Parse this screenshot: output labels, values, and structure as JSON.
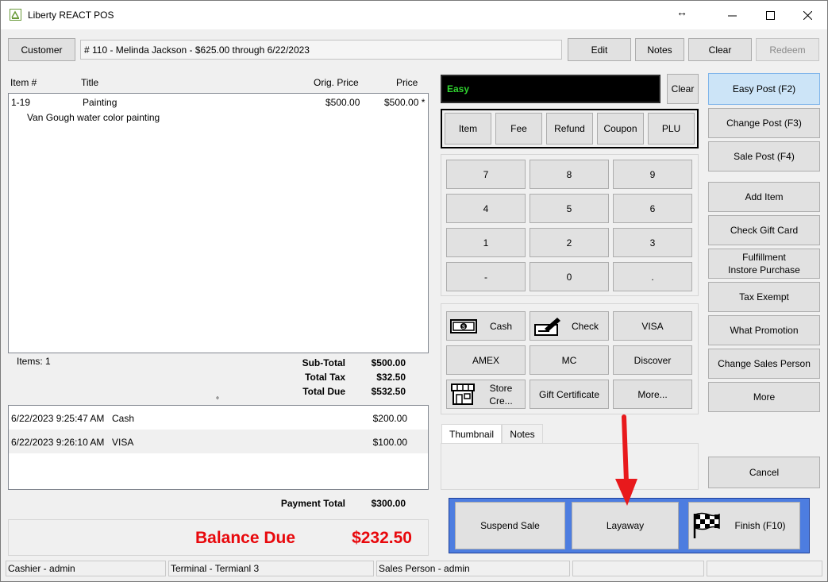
{
  "window": {
    "title": "Liberty REACT POS"
  },
  "customer": {
    "button_label": "Customer",
    "info": "# 110 - Melinda Jackson -  $625.00 through 6/22/2023",
    "edit_label": "Edit",
    "notes_label": "Notes",
    "clear_label": "Clear",
    "redeem_label": "Redeem"
  },
  "items": {
    "columns": [
      "Item #",
      "Title",
      "Orig. Price",
      "Price"
    ],
    "rows": [
      {
        "item_no": "1-19",
        "title": "Painting",
        "orig_price": "$500.00",
        "price": "$500.00 *",
        "description": "Van Gough water color painting"
      }
    ],
    "count_label": "Items: 1"
  },
  "totals": {
    "subtotal_label": "Sub-Total",
    "subtotal": "$500.00",
    "tax_label": "Total Tax",
    "tax": "$32.50",
    "due_label": "Total Due",
    "due": "$532.50"
  },
  "payments": {
    "rows": [
      {
        "time": "6/22/2023 9:25:47 AM",
        "method": "Cash",
        "amount": "$200.00"
      },
      {
        "time": "6/22/2023 9:26:10 AM",
        "method": "VISA",
        "amount": "$100.00"
      }
    ],
    "total_label": "Payment Total",
    "total": "$300.00"
  },
  "balance": {
    "label": "Balance Due",
    "amount": "$232.50",
    "color": "#e8080c"
  },
  "entry": {
    "display_text": "Easy",
    "display_color": "#2fd52f",
    "clear_label": "Clear"
  },
  "modes": {
    "item": "Item",
    "fee": "Fee",
    "refund": "Refund",
    "coupon": "Coupon",
    "plu": "PLU"
  },
  "keypad": {
    "keys": [
      "7",
      "8",
      "9",
      "4",
      "5",
      "6",
      "1",
      "2",
      "3",
      "-",
      "0",
      "."
    ]
  },
  "tenders": {
    "cash": "Cash",
    "check": "Check",
    "visa": "VISA",
    "amex": "AMEX",
    "mc": "MC",
    "discover": "Discover",
    "store_credit": "Store Cre...",
    "gift_certificate": "Gift Certificate",
    "more": "More..."
  },
  "tabs": {
    "thumbnail": "Thumbnail",
    "notes": "Notes"
  },
  "actions": {
    "easy_post": "Easy Post (F2)",
    "change_post": "Change Post (F3)",
    "sale_post": "Sale Post (F4)",
    "add_item": "Add Item",
    "check_gift_card": "Check Gift Card",
    "fulfillment": "Fulfillment\nInstore Purchase",
    "tax_exempt": "Tax Exempt",
    "what_promotion": "What Promotion",
    "change_sales_person": "Change Sales Person",
    "more": "More",
    "cancel": "Cancel"
  },
  "finish_bar": {
    "suspend": "Suspend Sale",
    "layaway": "Layaway",
    "finish": "Finish (F10)",
    "accent": "#4d7de0"
  },
  "status": {
    "cashier": "Cashier - admin",
    "terminal": "Terminal - Termianl 3",
    "sales_person": "Sales Person - admin"
  },
  "annotation": {
    "arrow_color": "#e8191c"
  }
}
